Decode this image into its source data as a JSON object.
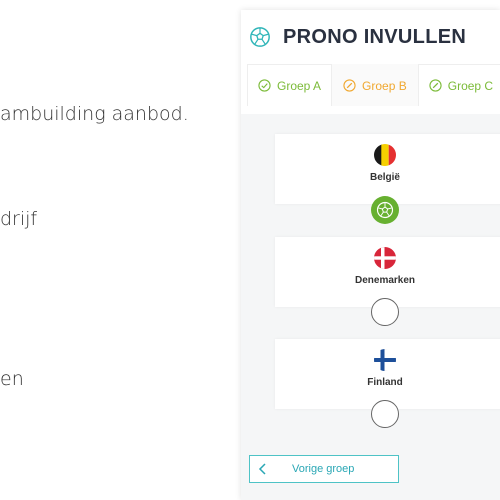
{
  "left_column": {
    "lines": [
      "ambuilding aanbod.",
      "drijf",
      "en"
    ]
  },
  "panel": {
    "title": "PRONO INVULLEN",
    "tabs": [
      {
        "label": "Groep A",
        "state": "done"
      },
      {
        "label": "Groep B",
        "state": "active"
      },
      {
        "label": "Groep C",
        "state": "done"
      }
    ],
    "teams": [
      {
        "name": "België",
        "selected": true
      },
      {
        "name": "Denemarken",
        "selected": false
      },
      {
        "name": "Finland",
        "selected": false
      }
    ],
    "prev_button_label": "Vorige groep"
  },
  "colors": {
    "accent_teal": "#2aa7b5",
    "done_green": "#7cbb39",
    "active_orange": "#f0a830",
    "selected_green": "#67b030"
  }
}
